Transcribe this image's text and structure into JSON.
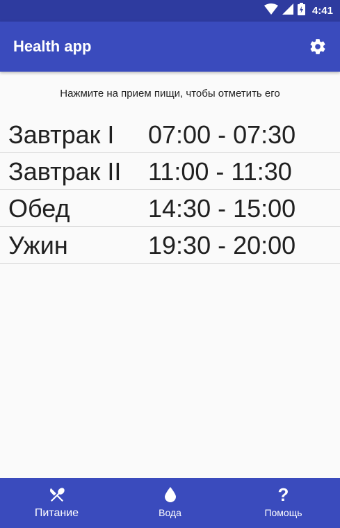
{
  "status_bar": {
    "time": "4:41"
  },
  "app_bar": {
    "title": "Health app"
  },
  "hint": "Нажмите на прием пищи, чтобы отметить его",
  "meals": [
    {
      "name": "Завтрак I",
      "time": "07:00 - 07:30"
    },
    {
      "name": "Завтрак II",
      "time": "11:00 - 11:30"
    },
    {
      "name": "Обед",
      "time": "14:30 - 15:00"
    },
    {
      "name": "Ужин",
      "time": "19:30 - 20:00"
    }
  ],
  "bottom_nav": [
    {
      "label": "Питание",
      "icon": "fork-knife-icon",
      "active": true
    },
    {
      "label": "Вода",
      "icon": "water-drop-icon",
      "active": false
    },
    {
      "label": "Помощь",
      "icon": "question-icon",
      "active": false
    }
  ],
  "colors": {
    "primary": "#3a4bbd",
    "primary_dark": "#2e3b9f"
  }
}
